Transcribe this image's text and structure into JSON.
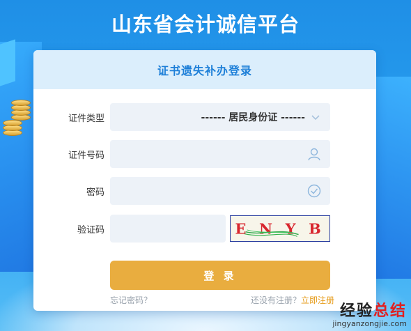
{
  "page": {
    "title": "山东省会计诚信平台"
  },
  "card": {
    "title": "证书遗失补办登录"
  },
  "form": {
    "cert_type": {
      "label": "证件类型",
      "selected": "------ 居民身份证 ------"
    },
    "cert_number": {
      "label": "证件号码",
      "value": "",
      "placeholder": ""
    },
    "password": {
      "label": "密码",
      "value": "",
      "placeholder": ""
    },
    "captcha": {
      "label": "验证码",
      "value": "",
      "placeholder": "",
      "image_text": "E N Y B"
    },
    "login_button": "登 录",
    "forgot_password": "忘记密码？",
    "no_account": "还没有注册？",
    "register_link": "立即注册"
  },
  "watermark": {
    "cn_left": "经验",
    "cn_right": "总结",
    "en": "jingyanzongjie.com"
  },
  "colors": {
    "background": "#2aa2f2",
    "card_header": "#dbeefc",
    "title_blue": "#1d7fd8",
    "button": "#e9ad3f",
    "register": "#e69a16",
    "field_bg": "#edf2f8"
  },
  "icons": {
    "select": "chevron-down-icon",
    "cert_number": "user-icon",
    "password": "check-circle-icon"
  }
}
